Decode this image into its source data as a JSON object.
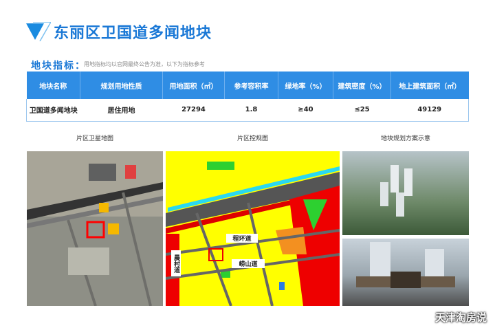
{
  "header": {
    "title": "东丽区卫国道多闻地块",
    "brand_color": "#1a78d6"
  },
  "section": {
    "heading": "地块指标：",
    "note": "用地指标均以官网最终公告为准，以下为指标参考"
  },
  "table": {
    "columns": [
      "地块名称",
      "规划用地性质",
      "用地面积（㎡）",
      "参考容积率",
      "绿地率（%）",
      "建筑密度（%）",
      "地上建筑面积（㎡）"
    ],
    "rows": [
      [
        "卫国道多闻地块",
        "居住用地",
        "27294",
        "1.8",
        "≥40",
        "≤25",
        "49129"
      ]
    ]
  },
  "captions": {
    "satellite": "片区卫星地图",
    "control": "片区控规图",
    "render": "地块规划方案示意"
  },
  "control_map": {
    "roads": [
      "程环道",
      "崂山道",
      "晨村道"
    ]
  },
  "watermark": "天津淘房说"
}
